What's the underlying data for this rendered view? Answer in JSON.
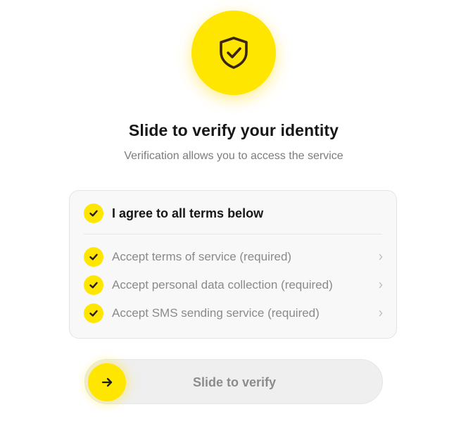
{
  "hero": {
    "icon": "shield-check-icon",
    "accent_color": "#ffe600",
    "icon_color": "#3a2414"
  },
  "header": {
    "title": "Slide to verify your identity",
    "subtitle": "Verification allows you to access the service"
  },
  "terms": {
    "agree_all": {
      "label": "I agree to all terms below",
      "checked": true
    },
    "items": [
      {
        "label": "Accept terms of service (required)",
        "checked": true,
        "icon": "chevron-right-icon"
      },
      {
        "label": "Accept personal data collection (required)",
        "checked": true,
        "icon": "chevron-right-icon"
      },
      {
        "label": "Accept SMS sending service (required)",
        "checked": true,
        "icon": "chevron-right-icon"
      }
    ]
  },
  "slider": {
    "label": "Slide to verify",
    "handle_icon": "arrow-right-icon",
    "progress": 0
  }
}
